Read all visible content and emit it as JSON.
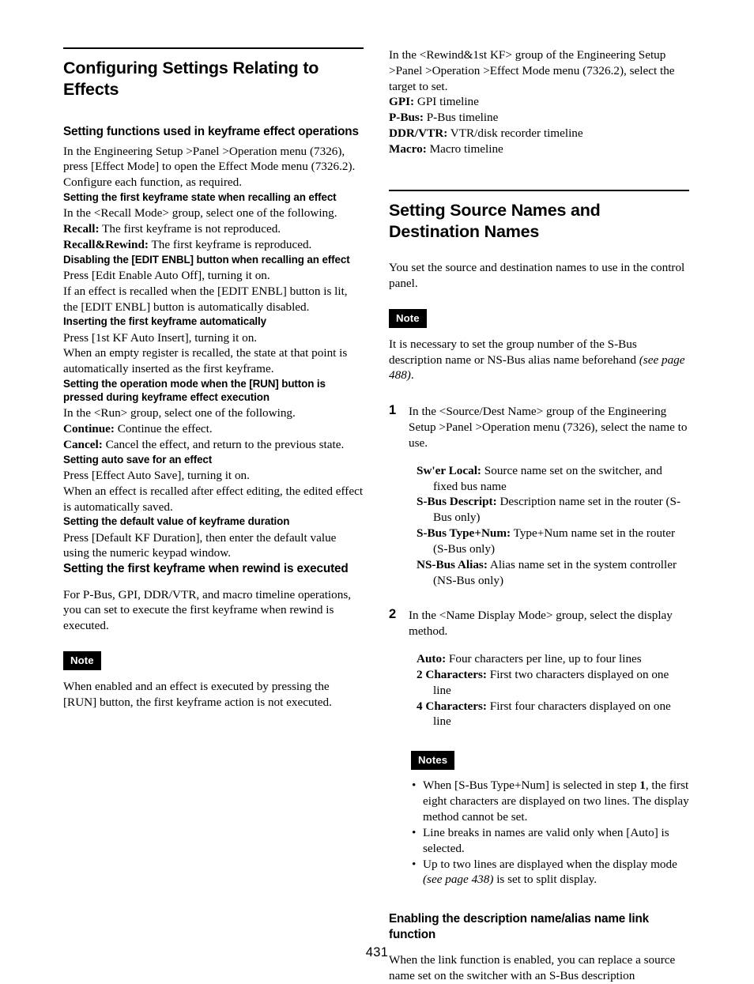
{
  "page": {
    "number": "431"
  },
  "left_column": {
    "major_heading": "Configuring Settings Relating to Effects",
    "section_1": {
      "heading": "Setting functions used in keyframe effect operations",
      "para_1": "In the Engineering Setup >Panel >Operation menu (7326), press [Effect Mode] to open the Effect Mode menu (7326.2).",
      "para_2": "Configure each function, as required."
    },
    "sub_1": {
      "heading": "Setting the first keyframe state when recalling an effect",
      "para": "In the <Recall Mode> group, select one of the following.",
      "defs": [
        {
          "term": "Recall:",
          "desc": " The first keyframe is not reproduced."
        },
        {
          "term": "Recall&Rewind:",
          "desc": " The first keyframe is reproduced."
        }
      ]
    },
    "sub_2": {
      "heading": "Disabling the [EDIT ENBL] button when recalling an effect",
      "para_1": "Press [Edit Enable Auto Off], turning it on.",
      "para_2": "If an effect is recalled when the [EDIT ENBL] button is lit, the [EDIT ENBL] button is automatically disabled."
    },
    "sub_3": {
      "heading": "Inserting the first keyframe automatically",
      "para_1": "Press [1st KF Auto Insert], turning it on.",
      "para_2": "When an empty register is recalled, the state at that point is automatically inserted as the first keyframe."
    },
    "sub_4": {
      "heading": "Setting the operation mode when the [RUN] button is pressed during keyframe effect execution",
      "para": "In the <Run> group, select one of the following.",
      "defs": [
        {
          "term": "Continue:",
          "desc": " Continue the effect."
        },
        {
          "term": "Cancel:",
          "desc": " Cancel the effect, and return to the previous state."
        }
      ]
    },
    "sub_5": {
      "heading": "Setting auto save for an effect",
      "para_1": "Press [Effect Auto Save], turning it on.",
      "para_2": "When an effect is recalled after effect editing, the edited effect is automatically saved."
    },
    "sub_6": {
      "heading": "Setting the default value of keyframe duration",
      "para": "Press [Default KF Duration], then enter the default value using the numeric keypad window."
    },
    "section_2": {
      "heading": "Setting the first keyframe when rewind is executed",
      "para": "For P-Bus, GPI, DDR/VTR, and macro timeline operations, you can set to execute the first keyframe when rewind is executed.",
      "note_label": "Note",
      "note_body": "When enabled and an effect is executed by pressing the [RUN] button, the first keyframe action is not executed."
    }
  },
  "right_column": {
    "continued": {
      "para": "In the <Rewind&1st KF> group of the Engineering Setup >Panel >Operation >Effect Mode menu (7326.2), select the target to set.",
      "defs": [
        {
          "term": "GPI:",
          "desc": " GPI timeline"
        },
        {
          "term": "P-Bus:",
          "desc": " P-Bus timeline"
        },
        {
          "term": "DDR/VTR:",
          "desc": " VTR/disk recorder timeline"
        },
        {
          "term": "Macro:",
          "desc": " Macro timeline"
        }
      ]
    },
    "major_heading": "Setting Source Names and Destination Names",
    "intro_para": "You set the source and destination names to use in the control panel.",
    "note_label": "Note",
    "note_body_pre": "It is necessary to set the group number of the S-Bus description name or NS-Bus alias name beforehand ",
    "note_body_ital": "(see page 488)",
    "note_body_post": ".",
    "steps": [
      {
        "number": "1",
        "body": "In the <Source/Dest Name> group of the Engineering Setup >Panel >Operation menu (7326), select the name to use.",
        "defs": [
          {
            "term": "Sw'er Local:",
            "desc": " Source name set on the switcher, and fixed bus name"
          },
          {
            "term": "S-Bus Descript:",
            "desc": " Description name set in the router (S-Bus only)"
          },
          {
            "term": "S-Bus Type+Num:",
            "desc": " Type+Num name set in the router (S-Bus only)"
          },
          {
            "term": "NS-Bus Alias:",
            "desc": " Alias name set in the system controller (NS-Bus only)"
          }
        ]
      },
      {
        "number": "2",
        "body": "In the <Name Display Mode> group, select the display method.",
        "defs": [
          {
            "term": "Auto:",
            "desc": " Four characters per line, up to four lines"
          },
          {
            "term": "2 Characters:",
            "desc": " First two characters displayed on one line"
          },
          {
            "term": "4 Characters:",
            "desc": " First four characters displayed on one line"
          }
        ]
      }
    ],
    "notes_label": "Notes",
    "notes_bullet_char": "•",
    "notes": [
      {
        "pre": "When [S-Bus Type+Num] is selected in step ",
        "bold": "1",
        "post": ", the first eight characters are displayed on two lines. The display method cannot be set.",
        "ital": "",
        "tail": ""
      },
      {
        "pre": "Line breaks in names are valid only when [Auto] is selected.",
        "bold": "",
        "post": "",
        "ital": "",
        "tail": ""
      },
      {
        "pre": "Up to two lines are displayed when the display mode ",
        "bold": "",
        "post": "",
        "ital": "(see page 438)",
        "tail": " is set to split display."
      }
    ],
    "final_section": {
      "heading": "Enabling the description name/alias name link function",
      "para": "When the link function is enabled, you can replace a source name set on the switcher with an S-Bus description"
    }
  }
}
